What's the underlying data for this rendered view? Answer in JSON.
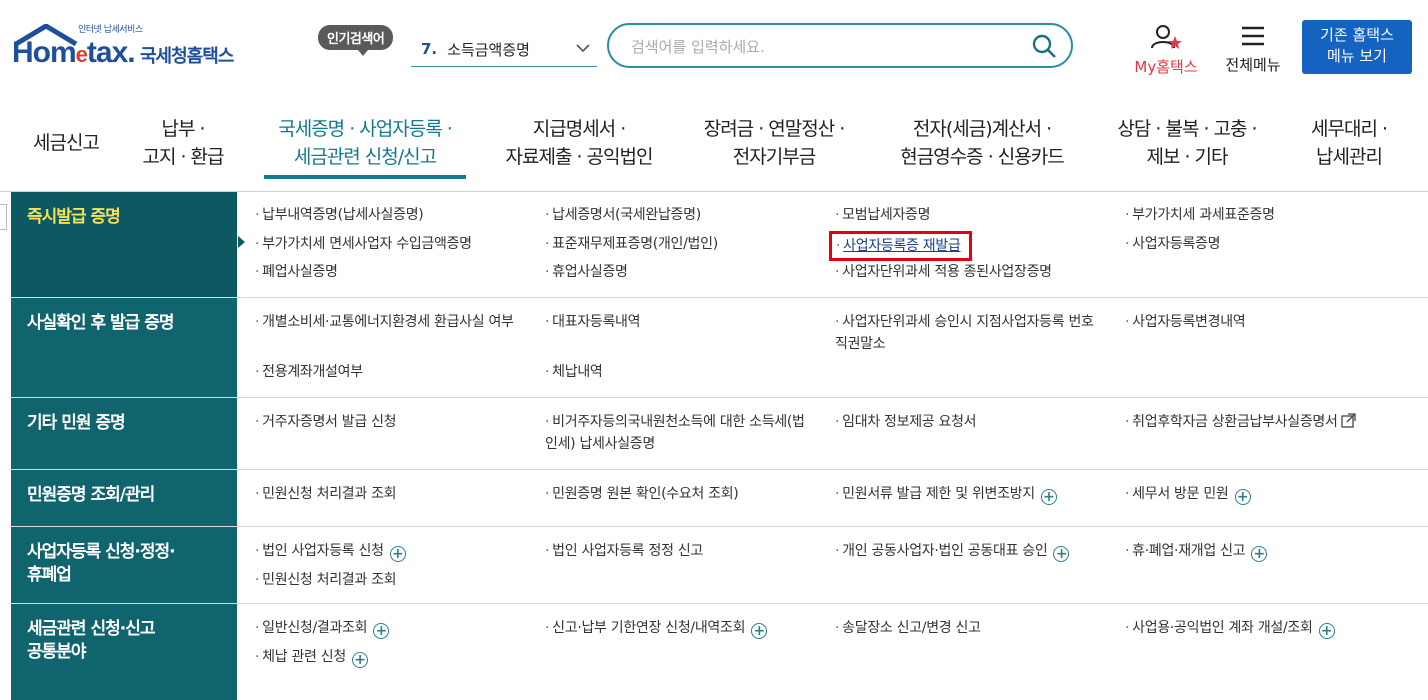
{
  "header": {
    "logo_small": "인터넷 납세서비스",
    "logo_brand_left": "Hom",
    "logo_brand_e": "e",
    "logo_brand_right": "tax.",
    "logo_korean": "국세청홈택스",
    "hot_badge": "인기검색어",
    "hot_number": "7.",
    "hot_keyword": "소득금액증명",
    "search_placeholder": "검색어를 입력하세요.",
    "my_home": "My홈택스",
    "all_menu": "전체메뉴",
    "old_home_line1": "기존 홈택스",
    "old_home_line2": "메뉴 보기"
  },
  "gnb": [
    {
      "line1": "세금신고",
      "line2": ""
    },
    {
      "line1": "납부 ·",
      "line2": "고지 · 환급"
    },
    {
      "line1": "국세증명 · 사업자등록 ·",
      "line2": "세금관련 신청/신고"
    },
    {
      "line1": "지급명세서 ·",
      "line2": "자료제출 · 공익법인"
    },
    {
      "line1": "장려금 · 연말정산 ·",
      "line2": "전자기부금"
    },
    {
      "line1": "전자(세금)계산서 ·",
      "line2": "현금영수증 · 신용카드"
    },
    {
      "line1": "상담 · 불복 · 고충 ·",
      "line2": "제보 · 기타"
    },
    {
      "line1": "세무대리 ·",
      "line2": "납세관리"
    }
  ],
  "rows": [
    {
      "category": "즉시발급 증명",
      "links": [
        "납부내역증명(납세사실증명)",
        "납세증명서(국세완납증명)",
        "모범납세자증명",
        "부가가치세 과세표준증명",
        "부가가치세 면세사업자 수입금액증명",
        "표준재무제표증명(개인/법인)",
        "사업자등록증 재발급",
        "사업자등록증명",
        "폐업사실증명",
        "휴업사실증명",
        "사업자단위과세 적용 종된사업장증명"
      ]
    },
    {
      "category": "사실확인 후 발급 증명",
      "links": [
        "개별소비세·교통에너지환경세 환급사실 여부",
        "대표자등록내역",
        "사업자단위과세 승인시 지점사업자등록 번호 직권말소",
        "사업자등록변경내역",
        "전용계좌개설여부",
        "체납내역"
      ]
    },
    {
      "category": "기타 민원 증명",
      "links": [
        "거주자증명서 발급 신청",
        "비거주자등의국내원천소득에 대한 소득세(법인세) 납세사실증명",
        "임대차 정보제공 요청서",
        "취업후학자금 상환금납부사실증명서"
      ]
    },
    {
      "category": "민원증명 조회/관리",
      "links": [
        "민원신청 처리결과 조회",
        "민원증명 원본 확인(수요처 조회)",
        "민원서류 발급 제한 및 위변조방지",
        "세무서 방문 민원"
      ]
    },
    {
      "category_line1": "사업자등록 신청·정정·",
      "category_line2": "휴폐업",
      "links": [
        "법인 사업자등록 신청",
        "법인 사업자등록 정정 신고",
        "개인 공동사업자·법인 공동대표 승인",
        "휴·폐업·재개업 신고",
        "민원신청 처리결과 조회"
      ]
    },
    {
      "category_line1": "세금관련 신청·신고",
      "category_line2": "공통분야",
      "links": [
        "일반신청/결과조회",
        "신고·납부 기한연장 신청/내역조회",
        "송달장소 신고/변경 신고",
        "사업용·공익법인 계좌 개설/조회",
        "체납 관련 신청"
      ]
    }
  ],
  "colors": {
    "category_bg": "#10646d",
    "active_category_text": "#f3e25a",
    "accent": "#127a8a",
    "highlight": "#e60012"
  }
}
